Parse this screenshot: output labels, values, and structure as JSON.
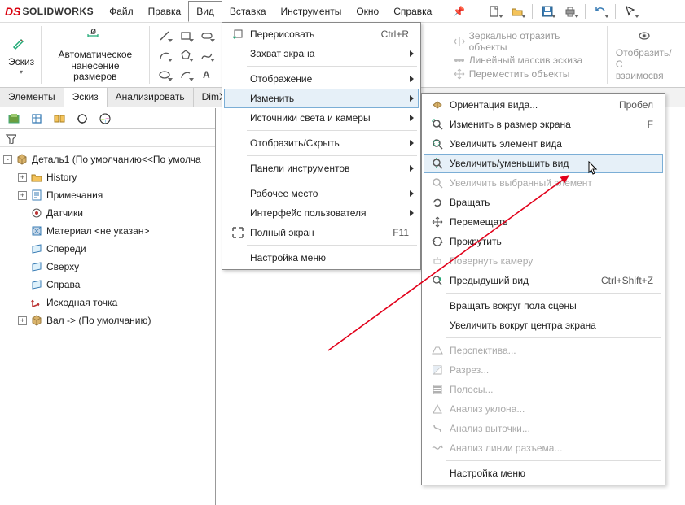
{
  "logo": {
    "ds": "DS",
    "name": "SOLIDWORKS"
  },
  "menubar": [
    "Файл",
    "Правка",
    "Вид",
    "Вставка",
    "Инструменты",
    "Окно",
    "Справка"
  ],
  "ribbon": {
    "sketch": "Эскиз",
    "autodim": "Автоматическое\nнанесение размеров",
    "mirror": "Зеркально отразить объекты",
    "linear": "Линейный массив эскиза",
    "move": "Переместить объекты",
    "show": "Отобразить/С\nвзаимосвя"
  },
  "tabs": [
    "Элементы",
    "Эскиз",
    "Анализировать",
    "DimXp"
  ],
  "tree": {
    "root": "Деталь1  (По умолчанию<<По умолча",
    "items": [
      "History",
      "Примечания",
      "Датчики",
      "Материал <не указан>",
      "Спереди",
      "Сверху",
      "Справа",
      "Исходная точка",
      "Вал -> (По умолчанию)"
    ]
  },
  "view_menu": [
    {
      "label": "Перерисовать",
      "shortcut": "Ctrl+R",
      "icon": "redraw"
    },
    {
      "label": "Захват экрана",
      "sub": true
    },
    {
      "sep": true
    },
    {
      "label": "Отображение",
      "sub": true
    },
    {
      "label": "Изменить",
      "sub": true,
      "hilite": true
    },
    {
      "label": "Источники света и камеры",
      "sub": true
    },
    {
      "sep": true
    },
    {
      "label": "Отобразить/Скрыть",
      "sub": true
    },
    {
      "sep": true
    },
    {
      "label": "Панели инструментов",
      "sub": true
    },
    {
      "sep": true
    },
    {
      "label": "Рабочее место",
      "sub": true
    },
    {
      "label": "Интерфейс пользователя",
      "sub": true
    },
    {
      "label": "Полный экран",
      "shortcut": "F11",
      "icon": "fullscreen"
    },
    {
      "sep": true
    },
    {
      "label": "Настройка меню"
    }
  ],
  "modify_menu": [
    {
      "label": "Ориентация вида...",
      "shortcut": "Пробел",
      "icon": "orient"
    },
    {
      "label": "Изменить в размер экрана",
      "shortcut": "F",
      "icon": "fit"
    },
    {
      "label": "Увеличить элемент вида",
      "icon": "zoomarea"
    },
    {
      "label": "Увеличить/уменьшить вид",
      "icon": "zoominout",
      "selected": true
    },
    {
      "label": "Увеличить выбранный элемент",
      "icon": "zoomsel",
      "disabled": true
    },
    {
      "label": "Вращать",
      "icon": "rotate"
    },
    {
      "label": "Перемещать",
      "icon": "pan"
    },
    {
      "label": "Прокрутить",
      "icon": "roll"
    },
    {
      "label": "Повернуть камеру",
      "icon": "turret",
      "disabled": true
    },
    {
      "label": "Предыдущий вид",
      "shortcut": "Ctrl+Shift+Z",
      "icon": "prev"
    },
    {
      "sep": true
    },
    {
      "label": "Вращать вокруг пола сцены"
    },
    {
      "label": "Увеличить вокруг центра экрана"
    },
    {
      "sep": true
    },
    {
      "label": "Перспектива...",
      "icon": "persp",
      "disabled": true
    },
    {
      "label": "Разрез...",
      "icon": "section",
      "disabled": true
    },
    {
      "label": "Полосы...",
      "icon": "zebra",
      "disabled": true
    },
    {
      "label": "Анализ уклона...",
      "icon": "draft",
      "disabled": true
    },
    {
      "label": "Анализ выточки...",
      "icon": "undercut",
      "disabled": true
    },
    {
      "label": "Анализ линии разъема...",
      "icon": "parting",
      "disabled": true
    },
    {
      "sep": true
    },
    {
      "label": "Настройка меню"
    }
  ]
}
